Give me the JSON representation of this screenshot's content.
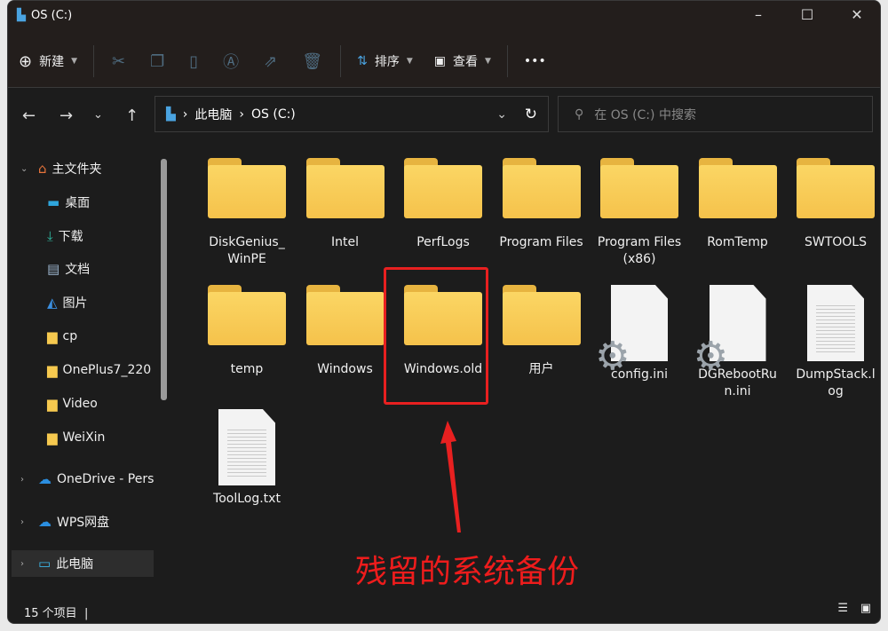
{
  "window": {
    "title": "OS (C:)",
    "minimize": "–",
    "maximize": "☐",
    "close": "✕"
  },
  "toolbar": {
    "new": "新建",
    "sort": "排序",
    "view": "查看",
    "more": "•••"
  },
  "address": {
    "path": [
      "此电脑",
      "OS (C:)"
    ],
    "search_placeholder": "在 OS (C:) 中搜索"
  },
  "sidebar": {
    "items": [
      {
        "label": "主文件夹",
        "icon": "home-icon"
      },
      {
        "label": "桌面",
        "icon": "desktop-icon",
        "pinned": true
      },
      {
        "label": "下载",
        "icon": "download-icon",
        "pinned": true
      },
      {
        "label": "文档",
        "icon": "document-icon",
        "pinned": true
      },
      {
        "label": "图片",
        "icon": "picture-icon",
        "pinned": true
      },
      {
        "label": "cp",
        "icon": "folder-icon"
      },
      {
        "label": "OnePlus7_220",
        "icon": "folder-icon"
      },
      {
        "label": "Video",
        "icon": "folder-icon"
      },
      {
        "label": "WeiXin",
        "icon": "folder-icon"
      },
      {
        "label": "OneDrive - Pers",
        "icon": "cloud-icon"
      },
      {
        "label": "WPS网盘",
        "icon": "cloud-icon"
      },
      {
        "label": "此电脑",
        "icon": "pc-icon"
      }
    ]
  },
  "files": [
    {
      "name": "DiskGenius_\nWinPE",
      "type": "folder"
    },
    {
      "name": "Intel",
      "type": "folder"
    },
    {
      "name": "PerfLogs",
      "type": "folder"
    },
    {
      "name": "Program Files",
      "type": "folder"
    },
    {
      "name": "Program Files\n(x86)",
      "type": "folder"
    },
    {
      "name": "RomTemp",
      "type": "folder"
    },
    {
      "name": "SWTOOLS",
      "type": "folder"
    },
    {
      "name": "temp",
      "type": "folder"
    },
    {
      "name": "Windows",
      "type": "folder"
    },
    {
      "name": "Windows.old",
      "type": "folder"
    },
    {
      "name": "用户",
      "type": "folder"
    },
    {
      "name": "config.ini",
      "type": "config"
    },
    {
      "name": "DGRebootRu\nn.ini",
      "type": "config"
    },
    {
      "name": "DumpStack.l\nog",
      "type": "doc"
    },
    {
      "name": "ToolLog.txt",
      "type": "doc"
    }
  ],
  "status": {
    "count": "15 个项目"
  },
  "annotation": {
    "text": "残留的系统备份",
    "color": "#ee1c1c"
  }
}
